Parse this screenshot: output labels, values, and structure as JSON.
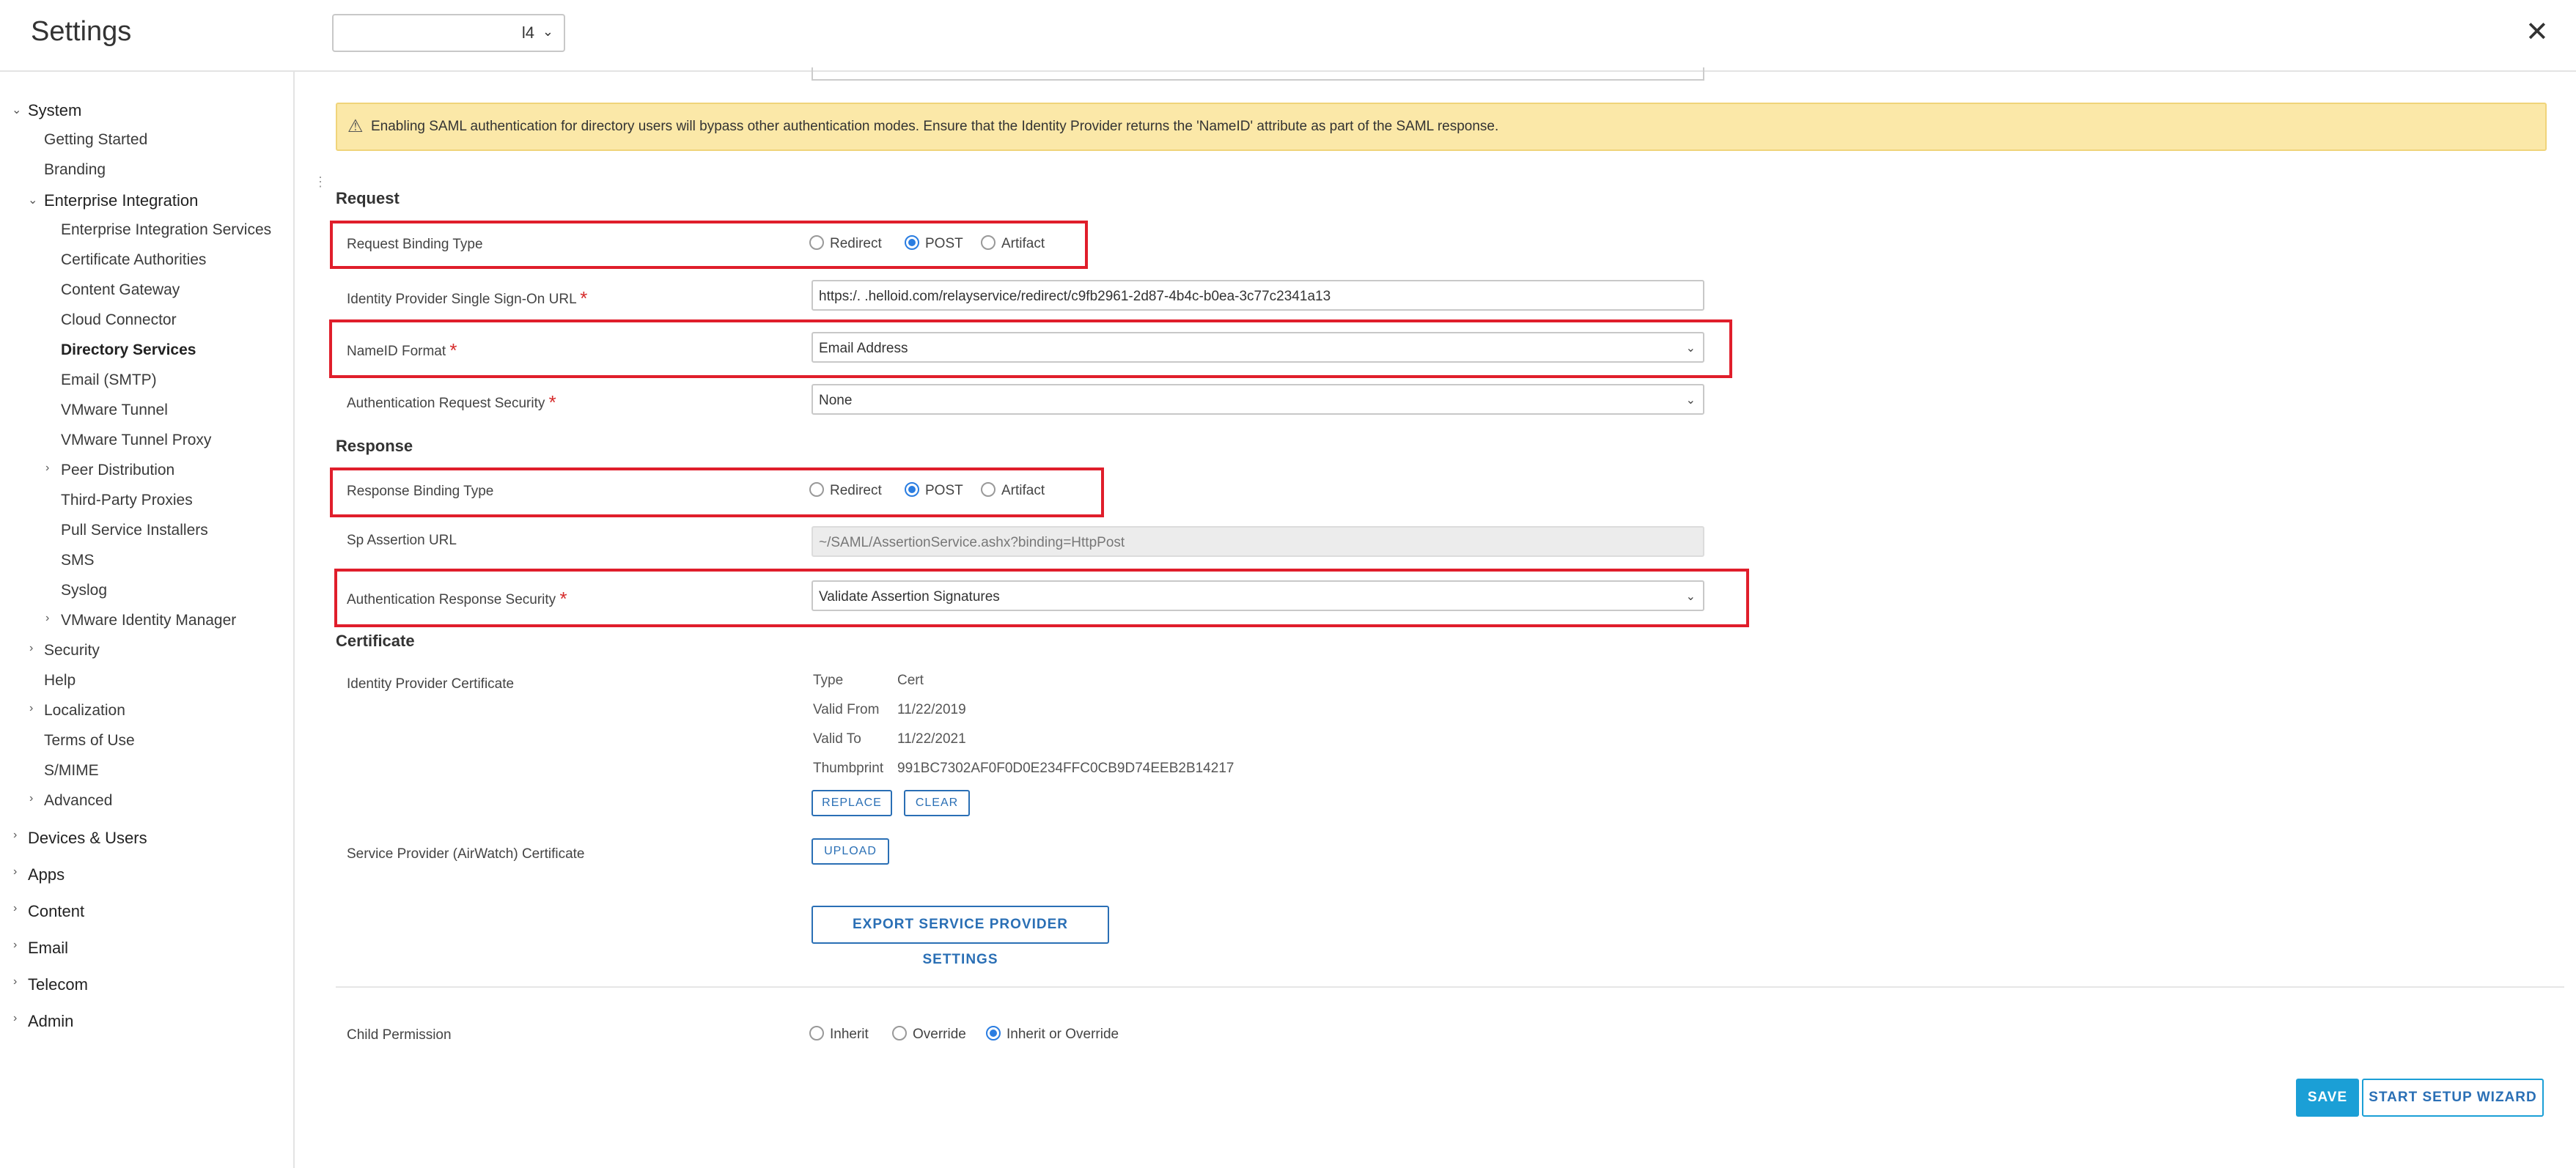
{
  "header": {
    "title": "Settings",
    "org_value": "l4",
    "close": "✕"
  },
  "sidebar": {
    "items": [
      {
        "label": "System"
      },
      {
        "label": "Getting Started"
      },
      {
        "label": "Branding"
      },
      {
        "label": "Enterprise Integration"
      },
      {
        "label": "Enterprise Integration Services"
      },
      {
        "label": "Certificate Authorities"
      },
      {
        "label": "Content Gateway"
      },
      {
        "label": "Cloud Connector"
      },
      {
        "label": "Directory Services"
      },
      {
        "label": "Email (SMTP)"
      },
      {
        "label": "VMware Tunnel"
      },
      {
        "label": "VMware Tunnel Proxy"
      },
      {
        "label": "Peer Distribution"
      },
      {
        "label": "Third-Party Proxies"
      },
      {
        "label": "Pull Service Installers"
      },
      {
        "label": "SMS"
      },
      {
        "label": "Syslog"
      },
      {
        "label": "VMware Identity Manager"
      },
      {
        "label": "Security"
      },
      {
        "label": "Help"
      },
      {
        "label": "Localization"
      },
      {
        "label": "Terms of Use"
      },
      {
        "label": "S/MIME"
      },
      {
        "label": "Advanced"
      },
      {
        "label": "Devices & Users"
      },
      {
        "label": "Apps"
      },
      {
        "label": "Content"
      },
      {
        "label": "Email"
      },
      {
        "label": "Telecom"
      },
      {
        "label": "Admin"
      }
    ]
  },
  "warning": "Enabling SAML authentication for directory users will bypass other authentication modes. Ensure that the Identity Provider returns the 'NameID' attribute as part of the SAML response.",
  "request": {
    "section": "Request",
    "binding_label": "Request Binding Type",
    "binding_options": [
      "Redirect",
      "POST",
      "Artifact"
    ],
    "binding_selected": "POST",
    "sso_url_label": "Identity Provider Single Sign-On URL",
    "sso_url_value": "https:/.      .helloid.com/relayservice/redirect/c9fb2961-2d87-4b4c-b0ea-3c77c2341a13",
    "nameid_label": "NameID Format",
    "nameid_value": "Email Address",
    "auth_req_sec_label": "Authentication Request Security",
    "auth_req_sec_value": "None"
  },
  "response": {
    "section": "Response",
    "binding_label": "Response Binding Type",
    "binding_options": [
      "Redirect",
      "POST",
      "Artifact"
    ],
    "binding_selected": "POST",
    "sp_assertion_label": "Sp Assertion URL",
    "sp_assertion_value": "~/SAML/AssertionService.ashx?binding=HttpPost",
    "auth_resp_sec_label": "Authentication Response Security",
    "auth_resp_sec_value": "Validate Assertion Signatures"
  },
  "certificate": {
    "section": "Certificate",
    "idp_cert_label": "Identity Provider Certificate",
    "rows": [
      {
        "k": "Type",
        "v": "Cert"
      },
      {
        "k": "Valid From",
        "v": "11/22/2019"
      },
      {
        "k": "Valid To",
        "v": "11/22/2021"
      },
      {
        "k": "Thumbprint",
        "v": "991BC7302AF0F0D0E234FFC0CB9D74EEB2B14217"
      }
    ],
    "replace": "REPLACE",
    "clear": "CLEAR",
    "sp_cert_label": "Service Provider (AirWatch) Certificate",
    "upload": "UPLOAD",
    "export": "EXPORT SERVICE PROVIDER SETTINGS"
  },
  "child_permission": {
    "label": "Child Permission",
    "options": [
      "Inherit",
      "Override",
      "Inherit or Override"
    ],
    "selected": "Inherit or Override"
  },
  "actions": {
    "save": "SAVE",
    "wizard": "START SETUP WIZARD"
  },
  "colors": {
    "highlight": "#e01e2b",
    "accent": "#1b9fd6",
    "radio_on": "#2a7de1",
    "warning_bg": "#fbe8a8"
  }
}
